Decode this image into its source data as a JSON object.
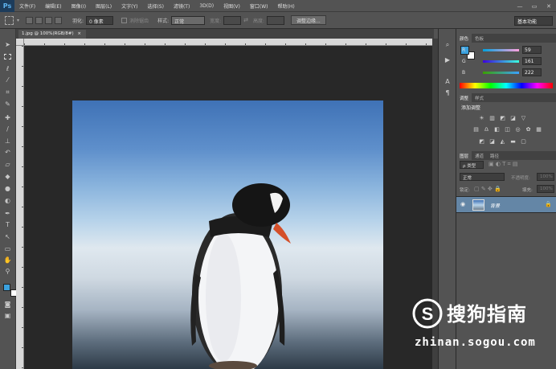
{
  "app": {
    "logo": "Ps"
  },
  "menu": [
    "文件(F)",
    "编辑(E)",
    "图像(I)",
    "图层(L)",
    "文字(Y)",
    "选择(S)",
    "滤镜(T)",
    "3D(D)",
    "视图(V)",
    "窗口(W)",
    "帮助(H)"
  ],
  "window_controls": [
    "minimize-icon",
    "restore-icon",
    "close-icon"
  ],
  "options": {
    "feather_label": "羽化:",
    "feather_value": "0 像素",
    "antialias_label": "消除锯齿",
    "style_label": "样式:",
    "style_value": "正常",
    "width_label": "宽度:",
    "height_label": "高度:",
    "refine_edge": "调整边缘...",
    "workspace": "基本功能"
  },
  "document": {
    "tab_label": "1.jpg @ 100%(RGB/8#)",
    "close": "×"
  },
  "color_panel": {
    "tabs": [
      "颜色",
      "色板"
    ],
    "foreground_color": "#3ba1de",
    "background_color": "#ffffff",
    "r_label": "R",
    "r_value": "59",
    "g_label": "G",
    "g_value": "161",
    "b_label": "B",
    "b_value": "222"
  },
  "adjust_panel": {
    "tabs": [
      "调整",
      "样式"
    ],
    "title": "添加调整"
  },
  "layers_panel": {
    "tabs": [
      "图层",
      "通道",
      "路径"
    ],
    "filter_value": "ρ 类型",
    "blend_mode": "正常",
    "opacity_label": "不透明度:",
    "opacity_value": "100%",
    "lock_label": "锁定:",
    "fill_label": "填充:",
    "fill_value": "100%",
    "layer_name": "背景"
  },
  "watermark": {
    "brand": "搜狗指南",
    "url": "zhinan.sogou.com"
  }
}
